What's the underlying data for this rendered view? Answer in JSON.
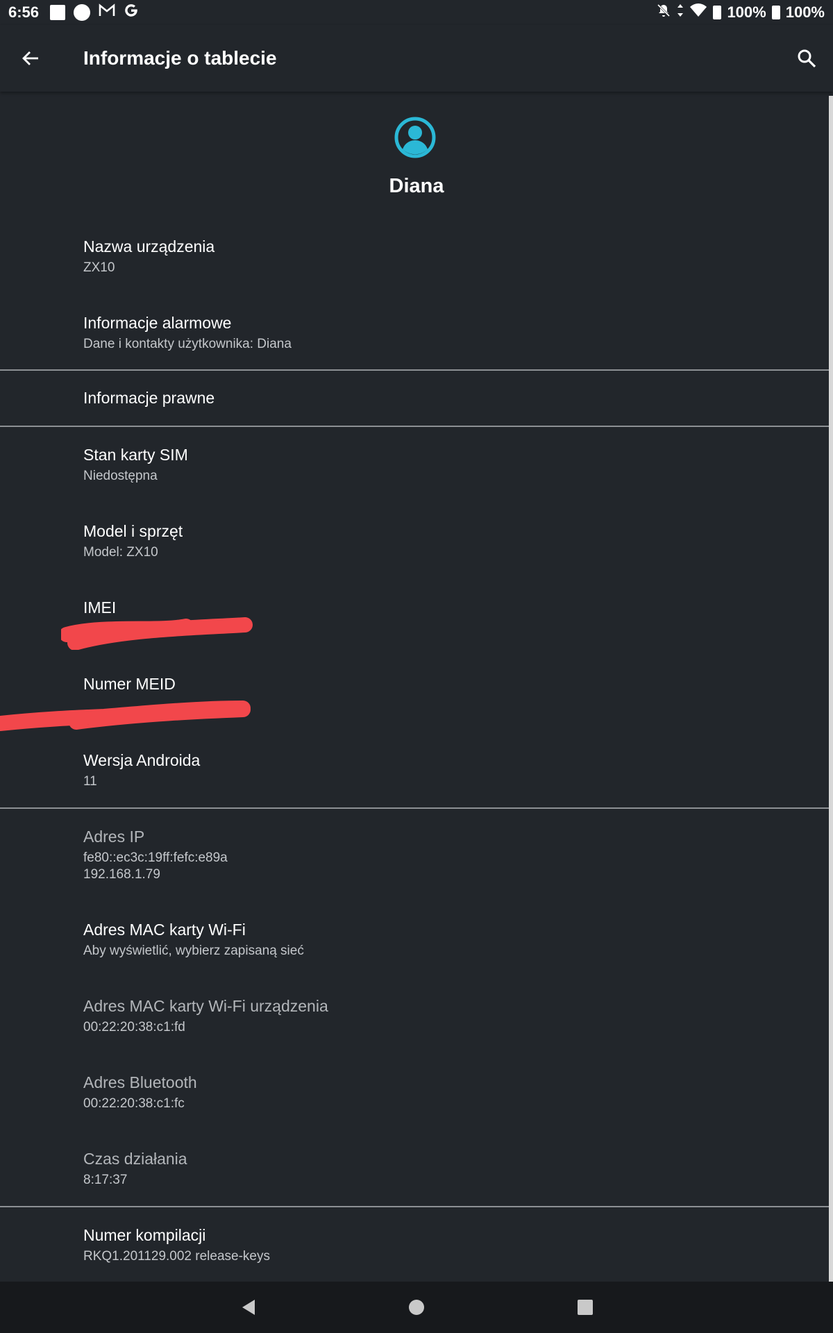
{
  "status_bar": {
    "time": "6:56",
    "icons_left": [
      "square-notification-icon",
      "circle-notification-icon",
      "gmail-icon",
      "google-icon"
    ],
    "battery_1": "100%",
    "battery_2": "100%"
  },
  "app_bar": {
    "title": "Informacje o tablecie"
  },
  "profile": {
    "name": "Diana",
    "avatar_color": "#2bb8d6"
  },
  "items": {
    "device_name": {
      "title": "Nazwa urządzenia",
      "summary": "ZX10"
    },
    "emergency": {
      "title": "Informacje alarmowe",
      "summary": "Dane i kontakty użytkownika: Diana"
    },
    "legal": {
      "title": "Informacje prawne"
    },
    "sim": {
      "title": "Stan karty SIM",
      "summary": "Niedostępna"
    },
    "model": {
      "title": "Model i sprzęt",
      "summary": "Model: ZX10"
    },
    "imei": {
      "title": "IMEI"
    },
    "meid": {
      "title": "Numer MEID"
    },
    "android": {
      "title": "Wersja Androida",
      "summary": "11"
    },
    "ip": {
      "title": "Adres IP",
      "summary_line1": "fe80::ec3c:19ff:fefc:e89a",
      "summary_line2": "192.168.1.79"
    },
    "wifi_mac": {
      "title": "Adres MAC karty Wi-Fi",
      "summary": "Aby wyświetlić, wybierz zapisaną sieć"
    },
    "device_wifi_mac": {
      "title": "Adres MAC karty Wi-Fi urządzenia",
      "summary": "00:22:20:38:c1:fd"
    },
    "bluetooth": {
      "title": "Adres Bluetooth",
      "summary": "00:22:20:38:c1:fc"
    },
    "uptime": {
      "title": "Czas działania",
      "summary": "8:17:37"
    },
    "build": {
      "title": "Numer kompilacji",
      "summary": "RKQ1.201129.002 release-keys"
    }
  },
  "colors": {
    "background": "#22262b",
    "redaction": "#f2474b",
    "accent": "#2bb8d6"
  }
}
